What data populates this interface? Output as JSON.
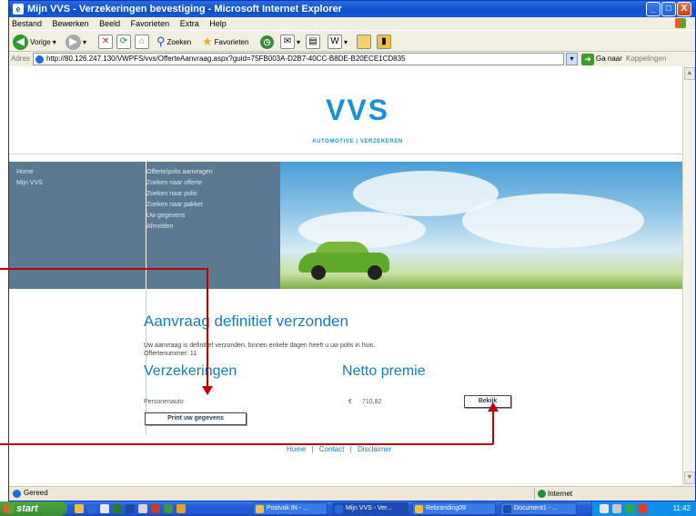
{
  "window": {
    "title": "Mijn VVS - Verzekeringen bevestiging - Microsoft Internet Explorer",
    "minimize": "_",
    "maximize": "□",
    "close": "X"
  },
  "menubar": [
    "Bestand",
    "Bewerken",
    "Beeld",
    "Favorieten",
    "Extra",
    "Help"
  ],
  "toolbar": {
    "back_label": "Vorige",
    "search_label": "Zoeken",
    "favorites_label": "Favorieten"
  },
  "address": {
    "label": "Adres",
    "url": "http://80.126.247.130/VWPFS/vvs/OfferteAanvraag.aspx?guid=75FB003A-D2B7-40CC-B8DE-B20ECE1CD835",
    "go_label": "Ga naar",
    "links_label": "Koppelingen"
  },
  "site": {
    "logo": "VVS",
    "tagline": "AUTOMOTIVE | VERZEKEREN",
    "nav_left": [
      "Home",
      "Mijn VVS"
    ],
    "nav_mid": [
      "Offerte/polis aanvragen",
      "Zoeken naar offerte",
      "Zoeken naar polis",
      "Zoeken naar pakket",
      "Uw gegevens",
      "Afmelden"
    ],
    "heading": "Aanvraag definitief verzonden",
    "message": "Uw aanvraag is definitief verzonden, binnen enkele dagen heeft u uw polis in huis.",
    "offer_number": "Offertenummer: 11",
    "insurance_heading": "Verzekeringen",
    "premium_heading": "Netto premie",
    "product": "Personenauto",
    "currency": "€",
    "premium": "710,82",
    "view_button": "Bekijk",
    "print_button": "Print uw gegevens",
    "footer_links": [
      "Home",
      "Contact",
      "Disclaimer"
    ],
    "footer_sep": "|"
  },
  "statusbar": {
    "text": "Gereed",
    "zone": "Internet"
  },
  "taskbar": {
    "start": "start",
    "tasks": [
      "Postvak IN - ...",
      "Mijn VVS - Ver...",
      "Rebranding09",
      "Document1 - ..."
    ],
    "clock": "11:42"
  },
  "colors": {
    "accent": "#1a7ac0",
    "nav_bg": "#5b7a92",
    "annotation": "#c00000",
    "title_bar": "#0a4fd0"
  }
}
